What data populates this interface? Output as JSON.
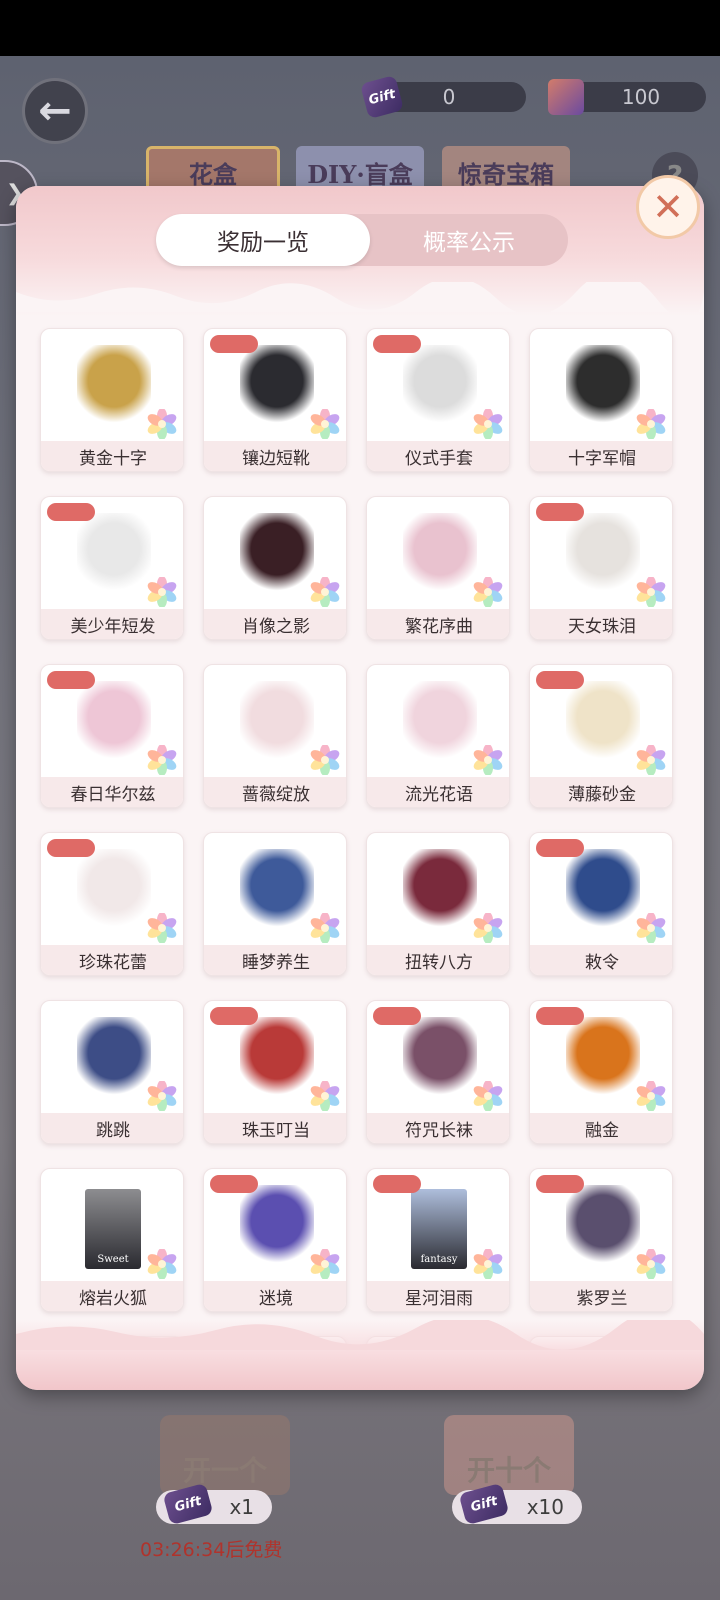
{
  "currencies": [
    {
      "icon": "ticket-icon",
      "icon_text": "Gift",
      "value": "0"
    },
    {
      "icon": "gem-icon",
      "value": "100"
    }
  ],
  "top_tabs": [
    "花盒",
    "DIY·盲盒",
    "惊奇宝箱"
  ],
  "help_label": "?",
  "modal": {
    "tabs": [
      "奖励一览",
      "概率公示"
    ],
    "active_tab": "奖励一览",
    "close_label": "✕"
  },
  "items": [
    {
      "name": "黄金十字",
      "tag": false,
      "color": "#c9a24a"
    },
    {
      "name": "镶边短靴",
      "tag": true,
      "color": "#2b2b30"
    },
    {
      "name": "仪式手套",
      "tag": true,
      "color": "#dcdcdc"
    },
    {
      "name": "十字军帽",
      "tag": false,
      "color": "#2d2d2d"
    },
    {
      "name": "美少年短发",
      "tag": true,
      "color": "#e8e8e8"
    },
    {
      "name": "肖像之影",
      "tag": false,
      "color": "#3a1f25"
    },
    {
      "name": "繁花序曲",
      "tag": false,
      "color": "#e9c2cf"
    },
    {
      "name": "天女珠泪",
      "tag": true,
      "color": "#e6e2de"
    },
    {
      "name": "春日华尔兹",
      "tag": true,
      "color": "#eec6d6"
    },
    {
      "name": "蔷薇绽放",
      "tag": false,
      "color": "#f1dcdf"
    },
    {
      "name": "流光花语",
      "tag": false,
      "color": "#f0d4dd"
    },
    {
      "name": "薄藤砂金",
      "tag": true,
      "color": "#efe3c8"
    },
    {
      "name": "珍珠花蕾",
      "tag": true,
      "color": "#f1e8e8"
    },
    {
      "name": "睡梦养生",
      "tag": false,
      "color": "#3e5a9a"
    },
    {
      "name": "扭转八方",
      "tag": false,
      "color": "#7a2a3c"
    },
    {
      "name": "敕令",
      "tag": true,
      "color": "#2f4c8c"
    },
    {
      "name": "跳跳",
      "tag": false,
      "color": "#3d4d86"
    },
    {
      "name": "珠玉叮当",
      "tag": true,
      "color": "#b93a38"
    },
    {
      "name": "符咒长袜",
      "tag": true,
      "color": "#7a5068"
    },
    {
      "name": "融金",
      "tag": true,
      "color": "#d9741c"
    },
    {
      "name": "熔岩火狐",
      "tag": false,
      "color": "#8d8d90"
    },
    {
      "name": "迷境",
      "tag": true,
      "color": "#5b4fb0"
    },
    {
      "name": "星河泪雨",
      "tag": true,
      "color": "#aebedc"
    },
    {
      "name": "紫罗兰",
      "tag": true,
      "color": "#5a4f6e"
    }
  ],
  "portrait_texts": {
    "熔岩火狐": "Sweet",
    "星河泪雨": "fantasy"
  },
  "bottom": {
    "open_one": "开一个",
    "open_ten": "开十个",
    "cost_one": "x1",
    "cost_ten": "x10",
    "free_timer": "03:26:34后免费"
  }
}
